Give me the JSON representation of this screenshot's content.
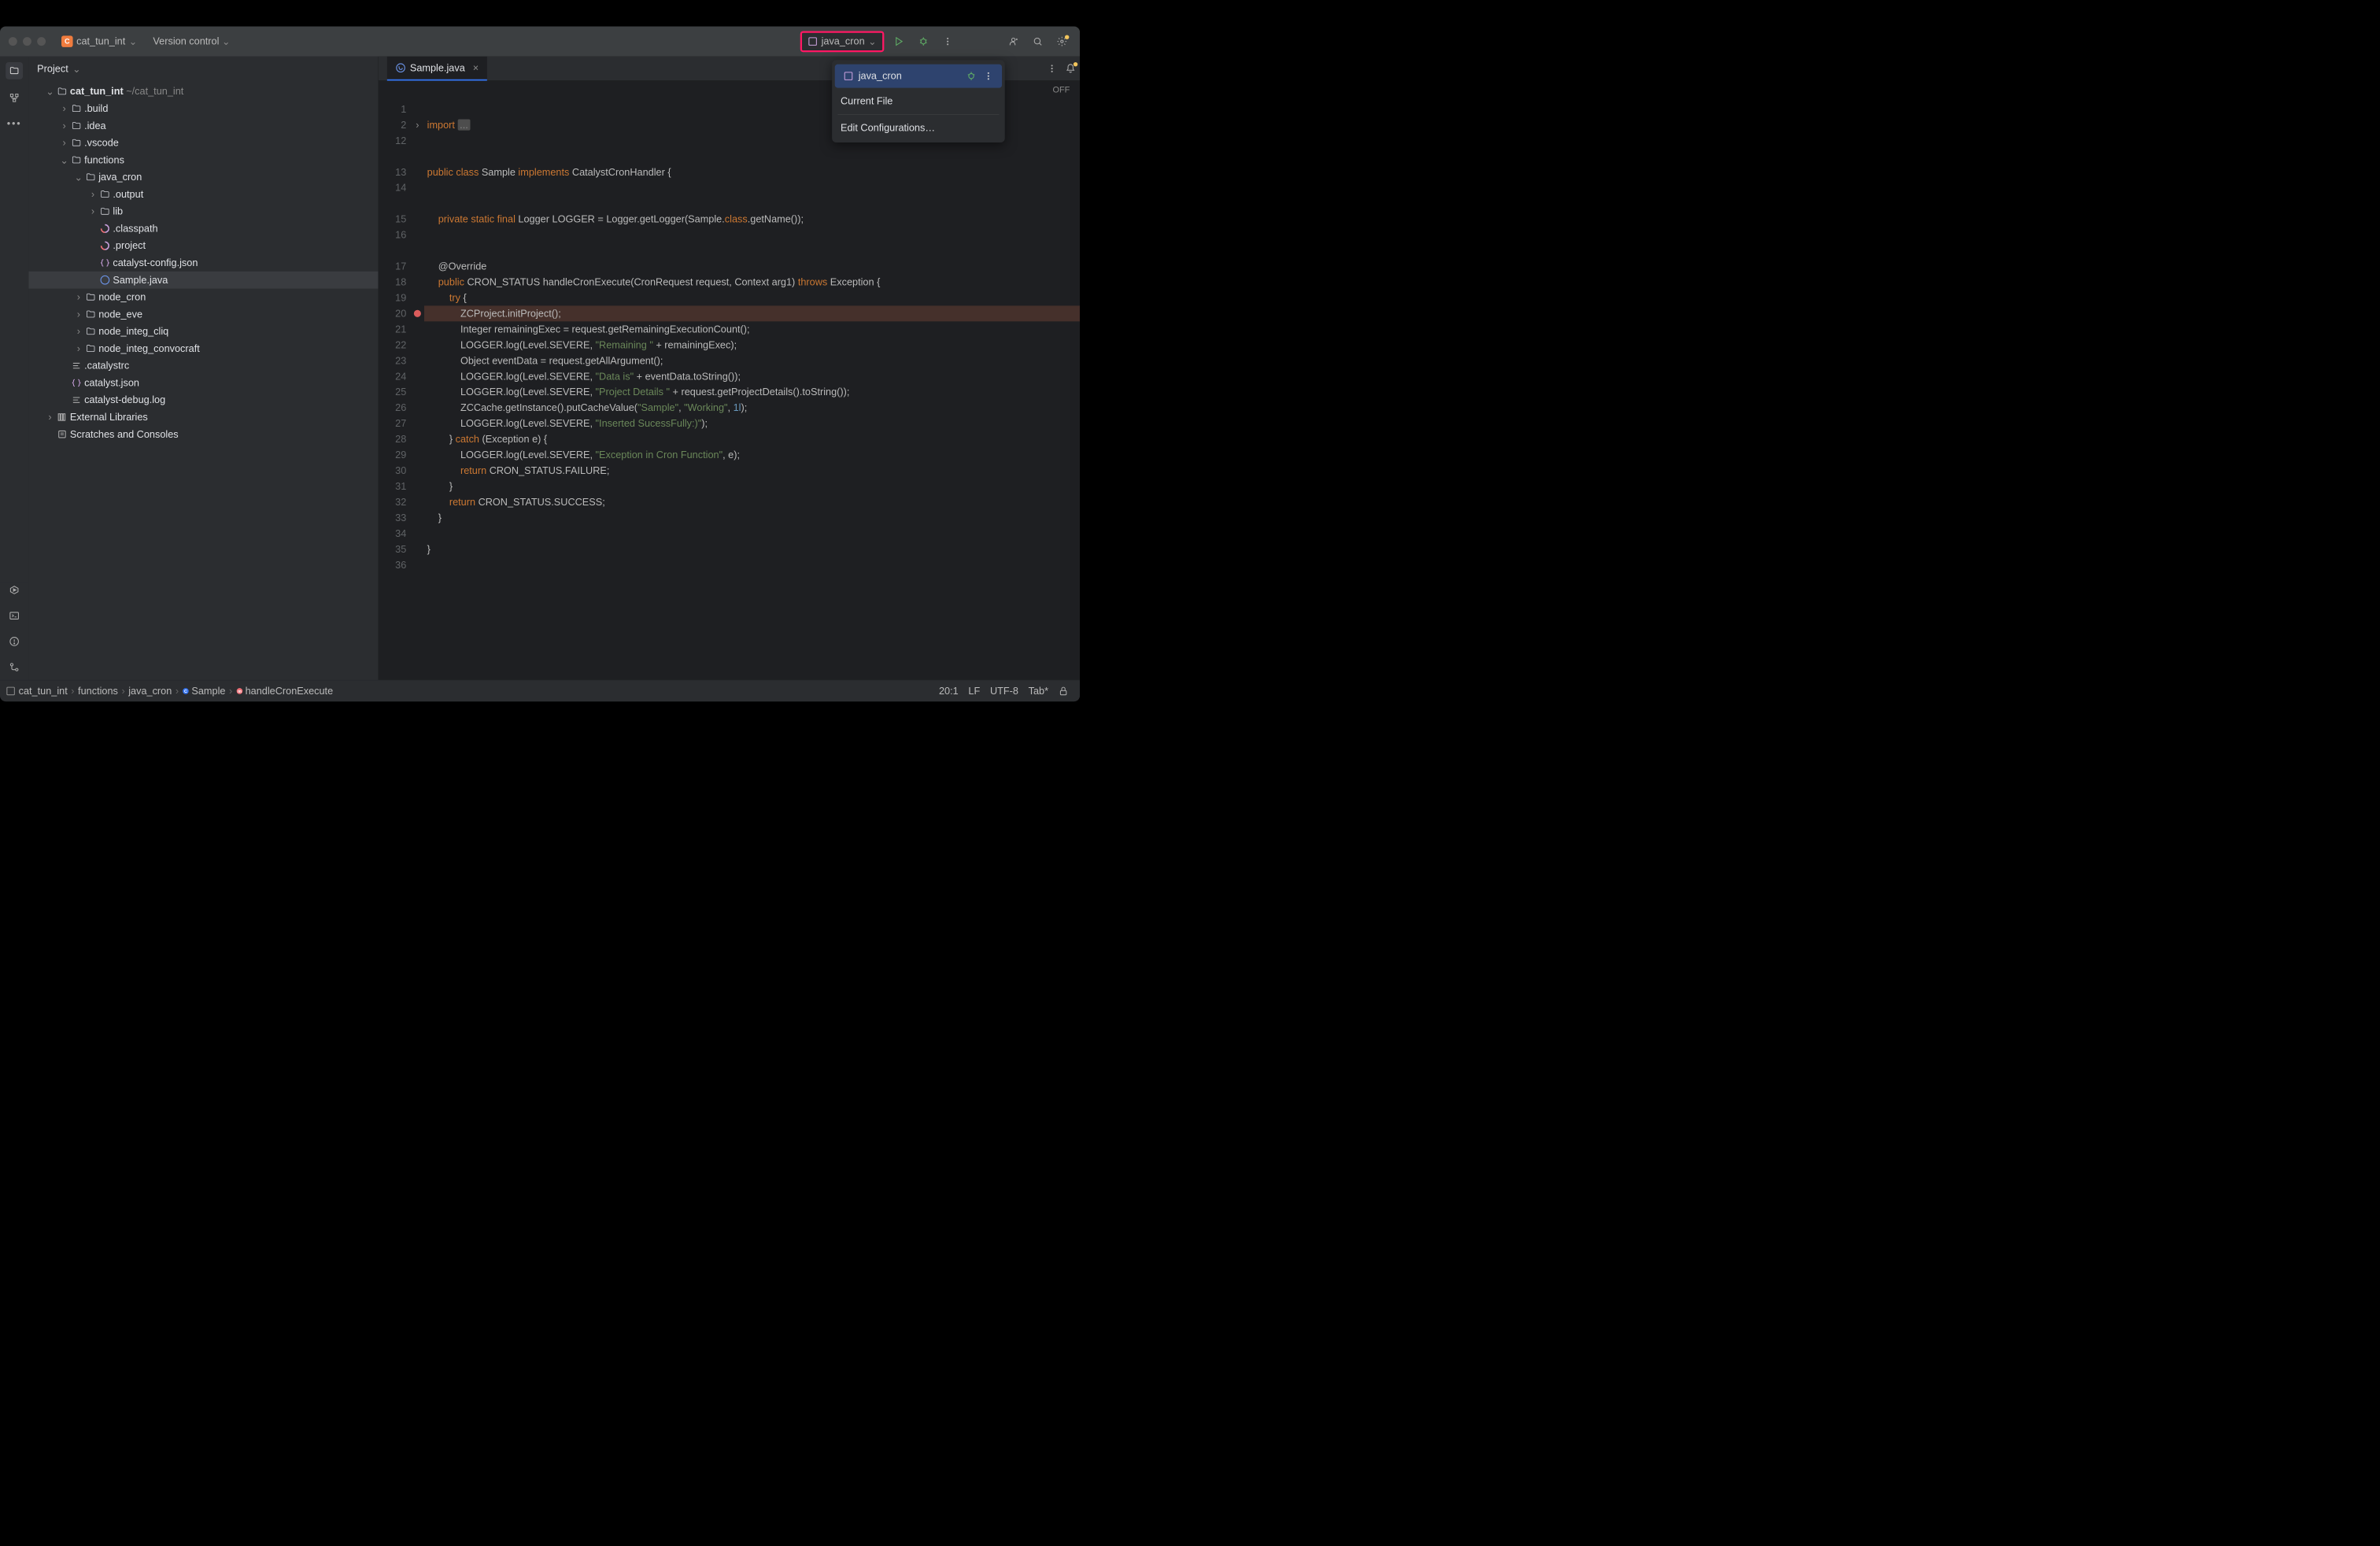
{
  "titlebar": {
    "project_name": "cat_tun_int",
    "version_control": "Version control",
    "run_config": "java_cron"
  },
  "sidebar": {
    "title": "Project",
    "tree": {
      "root": {
        "name": "cat_tun_int",
        "path": "~/cat_tun_int"
      },
      "build": ".build",
      "idea": ".idea",
      "vscode": ".vscode",
      "functions": "functions",
      "java_cron": "java_cron",
      "output": ".output",
      "lib": "lib",
      "classpath": ".classpath",
      "project": ".project",
      "catalyst_config": "catalyst-config.json",
      "sample": "Sample.java",
      "node_cron": "node_cron",
      "node_eve": "node_eve",
      "node_integ_cliq": "node_integ_cliq",
      "node_integ_convocraft": "node_integ_convocraft",
      "catalystrc": ".catalystrc",
      "catalyst_json": "catalyst.json",
      "catalyst_debug": "catalyst-debug.log",
      "ext_libs": "External Libraries",
      "scratches": "Scratches and Consoles"
    }
  },
  "tabs": {
    "active": "Sample.java",
    "off": "OFF"
  },
  "dropdown": {
    "selected": "java_cron",
    "current_file": "Current File",
    "edit": "Edit Configurations…"
  },
  "gutter_lines": [
    "1",
    "2",
    "12",
    "",
    "13",
    "14",
    "",
    "15",
    "16",
    "",
    "17",
    "18",
    "19",
    "20",
    "21",
    "22",
    "23",
    "24",
    "25",
    "26",
    "27",
    "28",
    "29",
    "30",
    "31",
    "32",
    "33",
    "34",
    "35",
    "36"
  ],
  "code_lines": [
    {
      "tokens": []
    },
    {
      "tokens": [
        {
          "t": "import ",
          "c": "pkg"
        },
        {
          "t": "...",
          "c": "dim",
          "bg": "#4d4d4d"
        }
      ]
    },
    {
      "tokens": []
    },
    {
      "tokens": []
    },
    {
      "tokens": [
        {
          "t": "public class ",
          "c": "kw"
        },
        {
          "t": "Sample ",
          "c": "cls"
        },
        {
          "t": "implements ",
          "c": "kw"
        },
        {
          "t": "CatalystCronHandler {",
          "c": "cls"
        }
      ]
    },
    {
      "tokens": []
    },
    {
      "tokens": []
    },
    {
      "tokens": [
        {
          "t": "    private static final ",
          "c": "kw"
        },
        {
          "t": "Logger LOGGER = Logger.getLogger(Sample.",
          "c": "cls"
        },
        {
          "t": "class",
          "c": "kw"
        },
        {
          "t": ".getName());",
          "c": "cls"
        }
      ]
    },
    {
      "tokens": []
    },
    {
      "tokens": []
    },
    {
      "tokens": [
        {
          "t": "    @Override",
          "c": "ann"
        }
      ]
    },
    {
      "tokens": [
        {
          "t": "    public ",
          "c": "kw"
        },
        {
          "t": "CRON_STATUS handleCronExecute(CronRequest request, Context arg1) ",
          "c": "cls"
        },
        {
          "t": "throws ",
          "c": "kw"
        },
        {
          "t": "Exception {",
          "c": "cls"
        }
      ]
    },
    {
      "tokens": [
        {
          "t": "        try ",
          "c": "kw"
        },
        {
          "t": "{",
          "c": "cls"
        }
      ]
    },
    {
      "tokens": [
        {
          "t": "            ZCProject.initProject();",
          "c": "cls"
        }
      ],
      "hl": true
    },
    {
      "tokens": [
        {
          "t": "            Integer remainingExec = request.getRemainingExecutionCount();",
          "c": "cls"
        }
      ]
    },
    {
      "tokens": [
        {
          "t": "            LOGGER.log(Level.SEVERE, ",
          "c": "cls"
        },
        {
          "t": "\"Remaining \"",
          "c": "str"
        },
        {
          "t": " + remainingExec);",
          "c": "cls"
        }
      ]
    },
    {
      "tokens": [
        {
          "t": "            Object eventData = request.getAllArgument();",
          "c": "cls"
        }
      ]
    },
    {
      "tokens": [
        {
          "t": "            LOGGER.log(Level.SEVERE, ",
          "c": "cls"
        },
        {
          "t": "\"Data is\"",
          "c": "str"
        },
        {
          "t": " + eventData.toString());",
          "c": "cls"
        }
      ]
    },
    {
      "tokens": [
        {
          "t": "            LOGGER.log(Level.SEVERE, ",
          "c": "cls"
        },
        {
          "t": "\"Project Details \"",
          "c": "str"
        },
        {
          "t": " + request.getProjectDetails().toString());",
          "c": "cls"
        }
      ]
    },
    {
      "tokens": [
        {
          "t": "            ZCCache.getInstance().putCacheValue(",
          "c": "cls"
        },
        {
          "t": "\"Sample\"",
          "c": "str"
        },
        {
          "t": ", ",
          "c": "cls"
        },
        {
          "t": "\"Working\"",
          "c": "str"
        },
        {
          "t": ", ",
          "c": "cls"
        },
        {
          "t": "1l",
          "c": "num"
        },
        {
          "t": ");",
          "c": "cls"
        }
      ]
    },
    {
      "tokens": [
        {
          "t": "            LOGGER.log(Level.SEVERE, ",
          "c": "cls"
        },
        {
          "t": "\"Inserted SucessFully:)\"",
          "c": "str"
        },
        {
          "t": ");",
          "c": "cls"
        }
      ]
    },
    {
      "tokens": [
        {
          "t": "        } ",
          "c": "cls"
        },
        {
          "t": "catch ",
          "c": "kw"
        },
        {
          "t": "(Exception e) {",
          "c": "cls"
        }
      ]
    },
    {
      "tokens": [
        {
          "t": "            LOGGER.log(Level.SEVERE, ",
          "c": "cls"
        },
        {
          "t": "\"Exception in Cron Function\"",
          "c": "str"
        },
        {
          "t": ", e);",
          "c": "cls"
        }
      ]
    },
    {
      "tokens": [
        {
          "t": "            return ",
          "c": "kw"
        },
        {
          "t": "CRON_STATUS.FAILURE;",
          "c": "cls"
        }
      ]
    },
    {
      "tokens": [
        {
          "t": "        }",
          "c": "cls"
        }
      ]
    },
    {
      "tokens": [
        {
          "t": "        return ",
          "c": "kw"
        },
        {
          "t": "CRON_STATUS.SUCCESS;",
          "c": "cls"
        }
      ]
    },
    {
      "tokens": [
        {
          "t": "    }",
          "c": "cls"
        }
      ]
    },
    {
      "tokens": []
    },
    {
      "tokens": [
        {
          "t": "}",
          "c": "cls"
        }
      ]
    },
    {
      "tokens": []
    }
  ],
  "breadcrumb": [
    "cat_tun_int",
    "functions",
    "java_cron",
    "Sample",
    "handleCronExecute"
  ],
  "status": {
    "pos": "20:1",
    "sep": "LF",
    "enc": "UTF-8",
    "indent": "Tab*"
  }
}
